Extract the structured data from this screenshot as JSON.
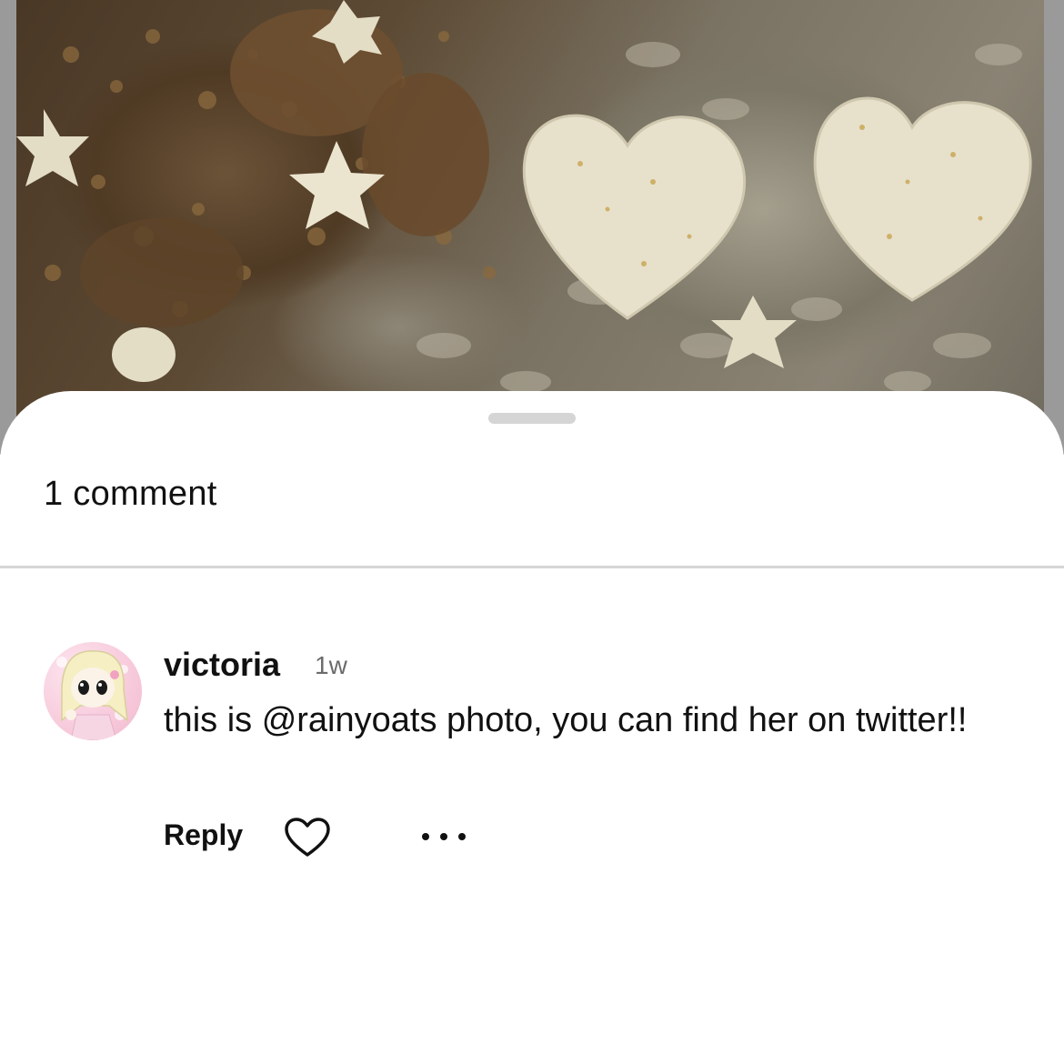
{
  "sheet": {
    "comment_count_label": "1 comment"
  },
  "comment": {
    "username": "victoria",
    "timestamp": "1w",
    "text": "this is @rainyoats photo, you can find her on twitter!!",
    "reply_label": "Reply",
    "like_icon": "heart-outline-icon",
    "more_icon": "more-horizontal-icon"
  },
  "colors": {
    "sheet_background": "#ffffff",
    "handle": "#d5d5d5",
    "divider": "#d6d6d6",
    "text_primary": "#111111",
    "text_secondary": "#6b6b6b"
  }
}
